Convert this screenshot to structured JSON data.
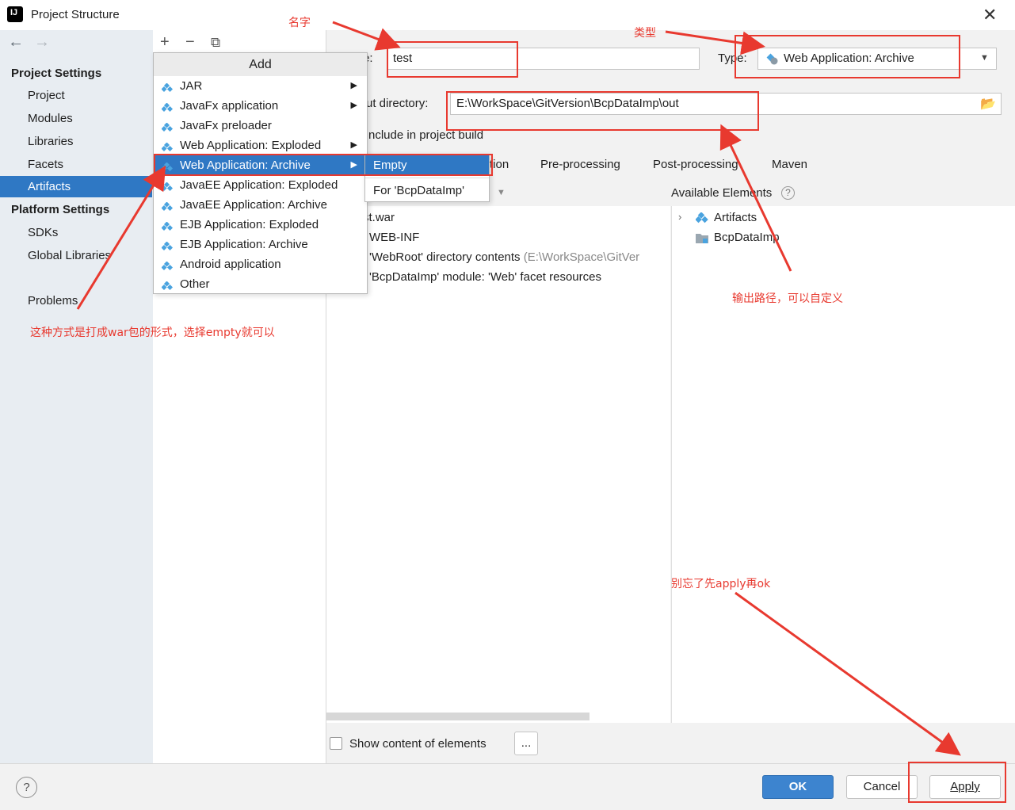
{
  "window": {
    "title": "Project Structure",
    "app_logo": "IJ"
  },
  "sidebar": {
    "project_settings_header": "Project Settings",
    "project_items": [
      "Project",
      "Modules",
      "Libraries",
      "Facets",
      "Artifacts"
    ],
    "platform_settings_header": "Platform Settings",
    "platform_items": [
      "SDKs",
      "Global Libraries"
    ],
    "problems": "Problems"
  },
  "menu": {
    "header": "Add",
    "items": [
      {
        "label": "JAR",
        "submenu": true
      },
      {
        "label": "JavaFx application",
        "submenu": true
      },
      {
        "label": "JavaFx preloader",
        "submenu": false
      },
      {
        "label": "Web Application: Exploded",
        "submenu": true
      },
      {
        "label": "Web Application: Archive",
        "submenu": true
      },
      {
        "label": "JavaEE Application: Exploded",
        "submenu": false
      },
      {
        "label": "JavaEE Application: Archive",
        "submenu": false
      },
      {
        "label": "EJB Application: Exploded",
        "submenu": false
      },
      {
        "label": "EJB Application: Archive",
        "submenu": false
      },
      {
        "label": "Android application",
        "submenu": false
      },
      {
        "label": "Other",
        "submenu": false
      }
    ],
    "selected_index": 4,
    "submenu_items": [
      "Empty",
      "For 'BcpDataImp'"
    ]
  },
  "form": {
    "name_label": "e:",
    "name_value": "test",
    "type_label": "Type:",
    "type_value": "Web Application: Archive",
    "output_label": "ut directory:",
    "output_value": "E:\\WorkSpace\\GitVersion\\BcpDataImp\\out",
    "include_label": "nclude in project build"
  },
  "tabs": [
    "tion",
    "Pre-processing",
    "Post-processing",
    "Maven"
  ],
  "tree": {
    "rows": [
      "st.war",
      "WEB-INF",
      "'WebRoot' directory contents",
      "'BcpDataImp' module: 'Web' facet resources"
    ],
    "webroot_path": "(E:\\WorkSpace\\GitVer"
  },
  "available": {
    "header": "Available Elements",
    "rows": [
      "Artifacts",
      "BcpDataImp"
    ]
  },
  "footer": {
    "show_content_label": "Show content of elements",
    "more_button": "...",
    "ok": "OK",
    "cancel": "Cancel",
    "apply": "Apply",
    "help": "?"
  },
  "annotations": {
    "name": "名字",
    "type": "类型",
    "output": "输出路径，可以自定义",
    "archive": "这种方式是打成war包的形式，选择empty就可以",
    "apply": "别忘了先apply再ok"
  },
  "colors": {
    "selection": "#2f78c4",
    "annotation": "#e8392f",
    "primary_button": "#3d84cf"
  }
}
